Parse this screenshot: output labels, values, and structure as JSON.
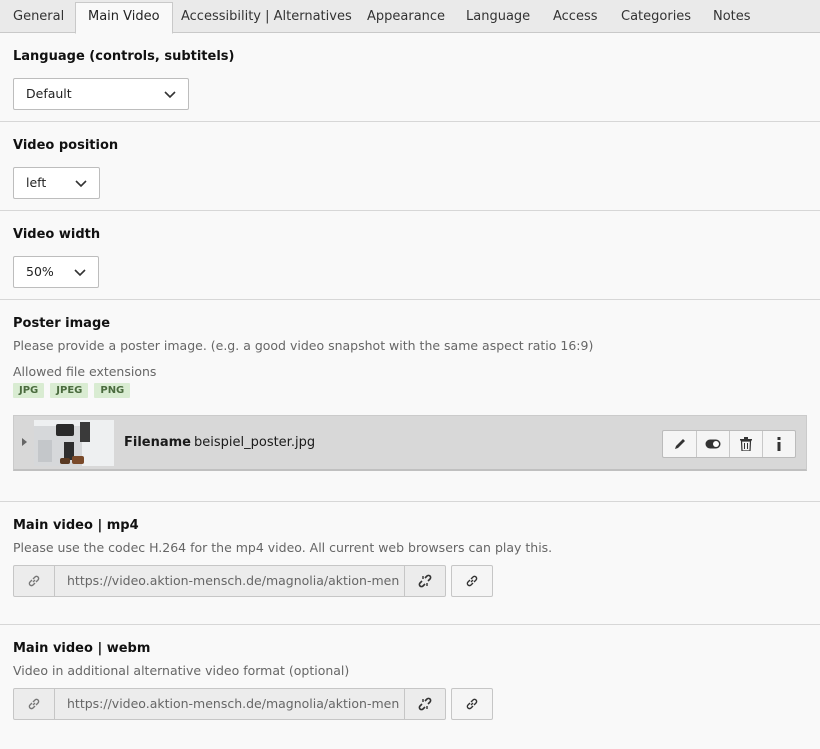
{
  "tabs": [
    {
      "label": "General"
    },
    {
      "label": "Main Video",
      "active": true
    },
    {
      "label": "Accessibility | Alternatives"
    },
    {
      "label": "Appearance"
    },
    {
      "label": "Language"
    },
    {
      "label": "Access"
    },
    {
      "label": "Categories"
    },
    {
      "label": "Notes"
    }
  ],
  "language": {
    "label": "Language (controls, subtitels)",
    "value": "Default"
  },
  "video_position": {
    "label": "Video position",
    "value": "left"
  },
  "video_width": {
    "label": "Video width",
    "value": "50%"
  },
  "poster": {
    "label": "Poster image",
    "description": "Please provide a poster image. (e.g. a good video snapshot with the same aspect ratio 16:9)",
    "allowed_label": "Allowed file extensions",
    "extensions": [
      "JPG",
      "JPEG",
      "PNG"
    ],
    "file": {
      "filename_label": "Filename",
      "filename": "beispiel_poster.jpg"
    }
  },
  "mp4": {
    "label": "Main video | mp4",
    "description": "Please use the codec H.264 for the mp4 video. All current web browsers can play this.",
    "url": "https://video.aktion-mensch.de/magnolia/aktion-men"
  },
  "webm": {
    "label": "Main video | webm",
    "description": "Video in additional alternative video format (optional)",
    "url": "https://video.aktion-mensch.de/magnolia/aktion-men"
  },
  "colors": {
    "badge_bg": "#d9ecd2",
    "badge_text": "#4a6b3e",
    "file_row_bg": "#d8d8d8"
  }
}
